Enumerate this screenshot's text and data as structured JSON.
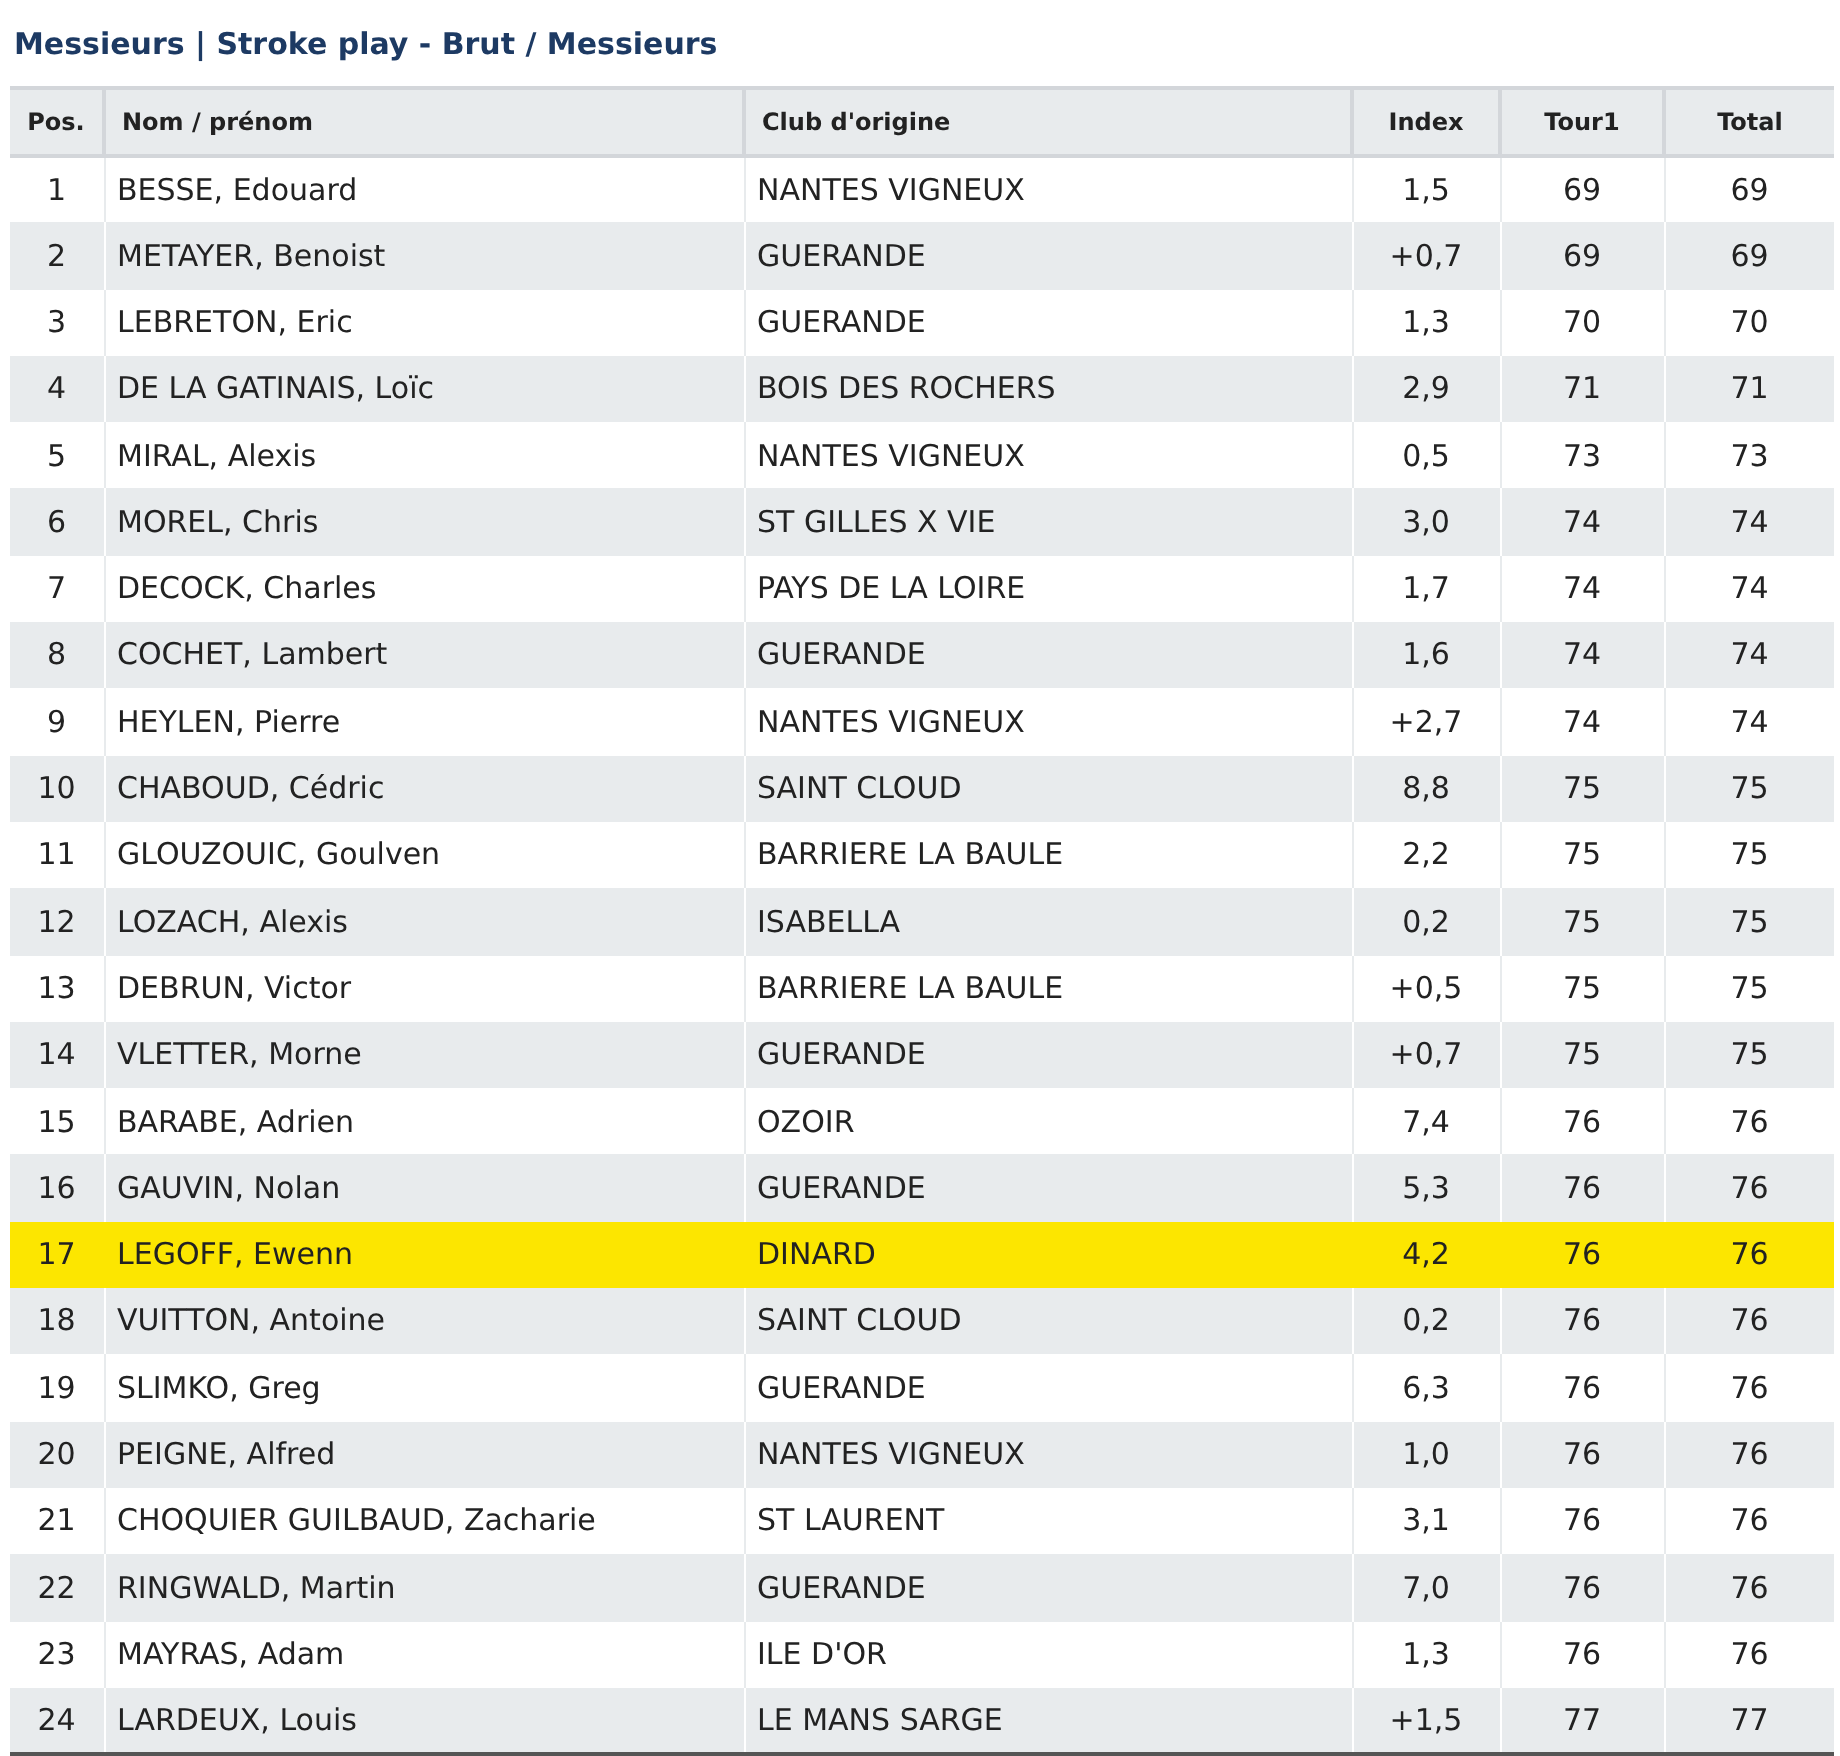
{
  "title": "Messieurs | Stroke play - Brut / Messieurs",
  "table": {
    "columns": [
      "Pos.",
      "Nom / prénom",
      "Club d'origine",
      "Index",
      "Tour1",
      "Total"
    ],
    "rows": [
      {
        "cells": [
          "1",
          "BESSE, Edouard",
          "NANTES VIGNEUX",
          "1,5",
          "69",
          "69"
        ],
        "highlighted": false
      },
      {
        "cells": [
          "2",
          "METAYER, Benoist",
          "GUERANDE",
          "+0,7",
          "69",
          "69"
        ],
        "highlighted": false
      },
      {
        "cells": [
          "3",
          "LEBRETON, Eric",
          "GUERANDE",
          "1,3",
          "70",
          "70"
        ],
        "highlighted": false
      },
      {
        "cells": [
          "4",
          "DE LA GATINAIS, Loïc",
          "BOIS DES ROCHERS",
          "2,9",
          "71",
          "71"
        ],
        "highlighted": false
      },
      {
        "cells": [
          "5",
          "MIRAL, Alexis",
          "NANTES VIGNEUX",
          "0,5",
          "73",
          "73"
        ],
        "highlighted": false
      },
      {
        "cells": [
          "6",
          "MOREL, Chris",
          "ST GILLES X VIE",
          "3,0",
          "74",
          "74"
        ],
        "highlighted": false
      },
      {
        "cells": [
          "7",
          "DECOCK, Charles",
          "PAYS DE LA LOIRE",
          "1,7",
          "74",
          "74"
        ],
        "highlighted": false
      },
      {
        "cells": [
          "8",
          "COCHET, Lambert",
          "GUERANDE",
          "1,6",
          "74",
          "74"
        ],
        "highlighted": false
      },
      {
        "cells": [
          "9",
          "HEYLEN, Pierre",
          "NANTES VIGNEUX",
          "+2,7",
          "74",
          "74"
        ],
        "highlighted": false
      },
      {
        "cells": [
          "10",
          "CHABOUD, Cédric",
          "SAINT CLOUD",
          "8,8",
          "75",
          "75"
        ],
        "highlighted": false
      },
      {
        "cells": [
          "11",
          "GLOUZOUIC, Goulven",
          "BARRIERE LA BAULE",
          "2,2",
          "75",
          "75"
        ],
        "highlighted": false
      },
      {
        "cells": [
          "12",
          "LOZACH, Alexis",
          "ISABELLA",
          "0,2",
          "75",
          "75"
        ],
        "highlighted": false
      },
      {
        "cells": [
          "13",
          "DEBRUN, Victor",
          "BARRIERE LA BAULE",
          "+0,5",
          "75",
          "75"
        ],
        "highlighted": false
      },
      {
        "cells": [
          "14",
          "VLETTER, Morne",
          "GUERANDE",
          "+0,7",
          "75",
          "75"
        ],
        "highlighted": false
      },
      {
        "cells": [
          "15",
          "BARABE, Adrien",
          "OZOIR",
          "7,4",
          "76",
          "76"
        ],
        "highlighted": false
      },
      {
        "cells": [
          "16",
          "GAUVIN, Nolan",
          "GUERANDE",
          "5,3",
          "76",
          "76"
        ],
        "highlighted": false
      },
      {
        "cells": [
          "17",
          "LEGOFF, Ewenn",
          "DINARD",
          "4,2",
          "76",
          "76"
        ],
        "highlighted": true
      },
      {
        "cells": [
          "18",
          "VUITTON, Antoine",
          "SAINT CLOUD",
          "0,2",
          "76",
          "76"
        ],
        "highlighted": false
      },
      {
        "cells": [
          "19",
          "SLIMKO, Greg",
          "GUERANDE",
          "6,3",
          "76",
          "76"
        ],
        "highlighted": false
      },
      {
        "cells": [
          "20",
          "PEIGNE, Alfred",
          "NANTES VIGNEUX",
          "1,0",
          "76",
          "76"
        ],
        "highlighted": false
      },
      {
        "cells": [
          "21",
          "CHOQUIER GUILBAUD, Zacharie",
          "ST LAURENT",
          "3,1",
          "76",
          "76"
        ],
        "highlighted": false
      },
      {
        "cells": [
          "22",
          "RINGWALD, Martin",
          "GUERANDE",
          "7,0",
          "76",
          "76"
        ],
        "highlighted": false
      },
      {
        "cells": [
          "23",
          "MAYRAS, Adam",
          "ILE D'OR",
          "1,3",
          "76",
          "76"
        ],
        "highlighted": false
      },
      {
        "cells": [
          "24",
          "LARDEUX, Louis",
          "LE MANS SARGE",
          "+1,5",
          "77",
          "77"
        ],
        "highlighted": false
      }
    ]
  }
}
